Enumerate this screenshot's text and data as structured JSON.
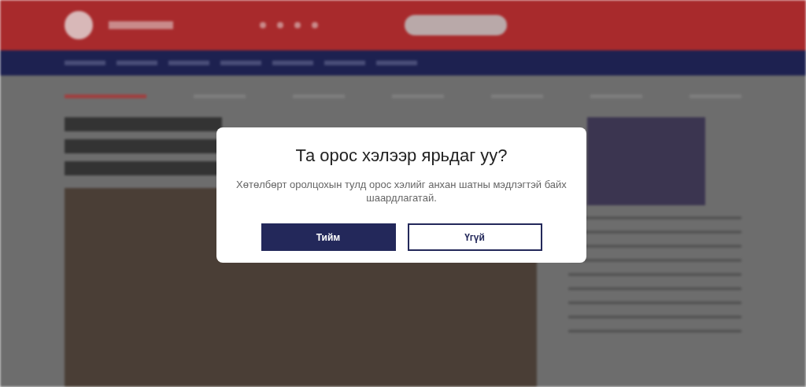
{
  "dialog": {
    "title": "Та орос хэлээр ярьдаг уу?",
    "message": "Хөтөлбөрт оролцохын тулд орос хэлийг анхан шатны мэдлэгтэй байх шаардлагатай.",
    "buttons": [
      {
        "label": "Тийм",
        "kind": "primary"
      },
      {
        "label": "Үгүй",
        "kind": "secondary"
      }
    ]
  }
}
